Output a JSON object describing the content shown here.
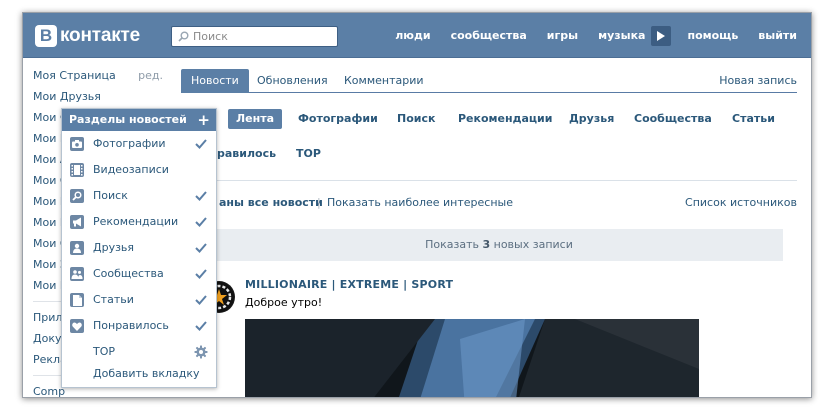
{
  "colors": {
    "header": "#5b7fa6",
    "link": "#2b587a",
    "check": "#5b7fa6"
  },
  "header": {
    "logo_mark": "В",
    "logo_text": "контакте",
    "search_placeholder": "Поиск",
    "nav": [
      "люди",
      "сообщества",
      "игры",
      "музыка",
      "помощь",
      "выйти"
    ]
  },
  "sidebar": {
    "items": [
      {
        "label": "Моя Страница",
        "edit": "ред."
      },
      {
        "label": "Мои Друзья"
      },
      {
        "label": "Мои Ф"
      },
      {
        "label": "Мои В"
      },
      {
        "label": "Мои А"
      },
      {
        "label": "Мои С"
      },
      {
        "label": "Мои Г"
      },
      {
        "label": "Мои Н"
      },
      {
        "label": "Мои О"
      },
      {
        "label": "Мои З"
      },
      {
        "label": "Мои Н"
      }
    ],
    "items2": [
      {
        "label": "Прило"
      },
      {
        "label": "Докум"
      },
      {
        "label": "Рекла"
      }
    ],
    "items3": [
      {
        "label": "Comp"
      }
    ]
  },
  "tabs": {
    "items": [
      "Новости",
      "Обновления",
      "Комментарии"
    ],
    "active": 0,
    "new_post": "Новая запись"
  },
  "sections": {
    "row1": [
      "Лента",
      "Фотографии",
      "Поиск",
      "Рекомендации",
      "Друзья",
      "Сообщества",
      "Статьи"
    ],
    "row2": [
      "равилось",
      "TOP"
    ],
    "active": "Лента"
  },
  "filters": {
    "active": "аны все новости",
    "separator": "|",
    "alt": "Показать наиболее интересные",
    "sources": "Список источников"
  },
  "new_posts": {
    "prefix": "Показать ",
    "count": "3",
    "suffix": " новых записи"
  },
  "post": {
    "title": "MILLIONAIRE | EXTREME | SPORT",
    "text": "Доброе утро!"
  },
  "dropdown": {
    "title": "Разделы новостей",
    "plus": "+",
    "items": [
      {
        "label": "Фотографии",
        "icon": "camera-icon",
        "checked": true
      },
      {
        "label": "Видеозаписи",
        "icon": "film-icon",
        "checked": false
      },
      {
        "label": "Поиск",
        "icon": "search-icon",
        "checked": true
      },
      {
        "label": "Рекомендации",
        "icon": "megaphone-icon",
        "checked": true
      },
      {
        "label": "Друзья",
        "icon": "person-icon",
        "checked": true
      },
      {
        "label": "Сообщества",
        "icon": "people-icon",
        "checked": true
      },
      {
        "label": "Статьи",
        "icon": "article-icon",
        "checked": true
      },
      {
        "label": "Понравилось",
        "icon": "heart-icon",
        "checked": true
      },
      {
        "label": "TOP",
        "icon": "none",
        "checked": false,
        "gear": true
      }
    ],
    "add_tab": "Добавить вкладку"
  }
}
